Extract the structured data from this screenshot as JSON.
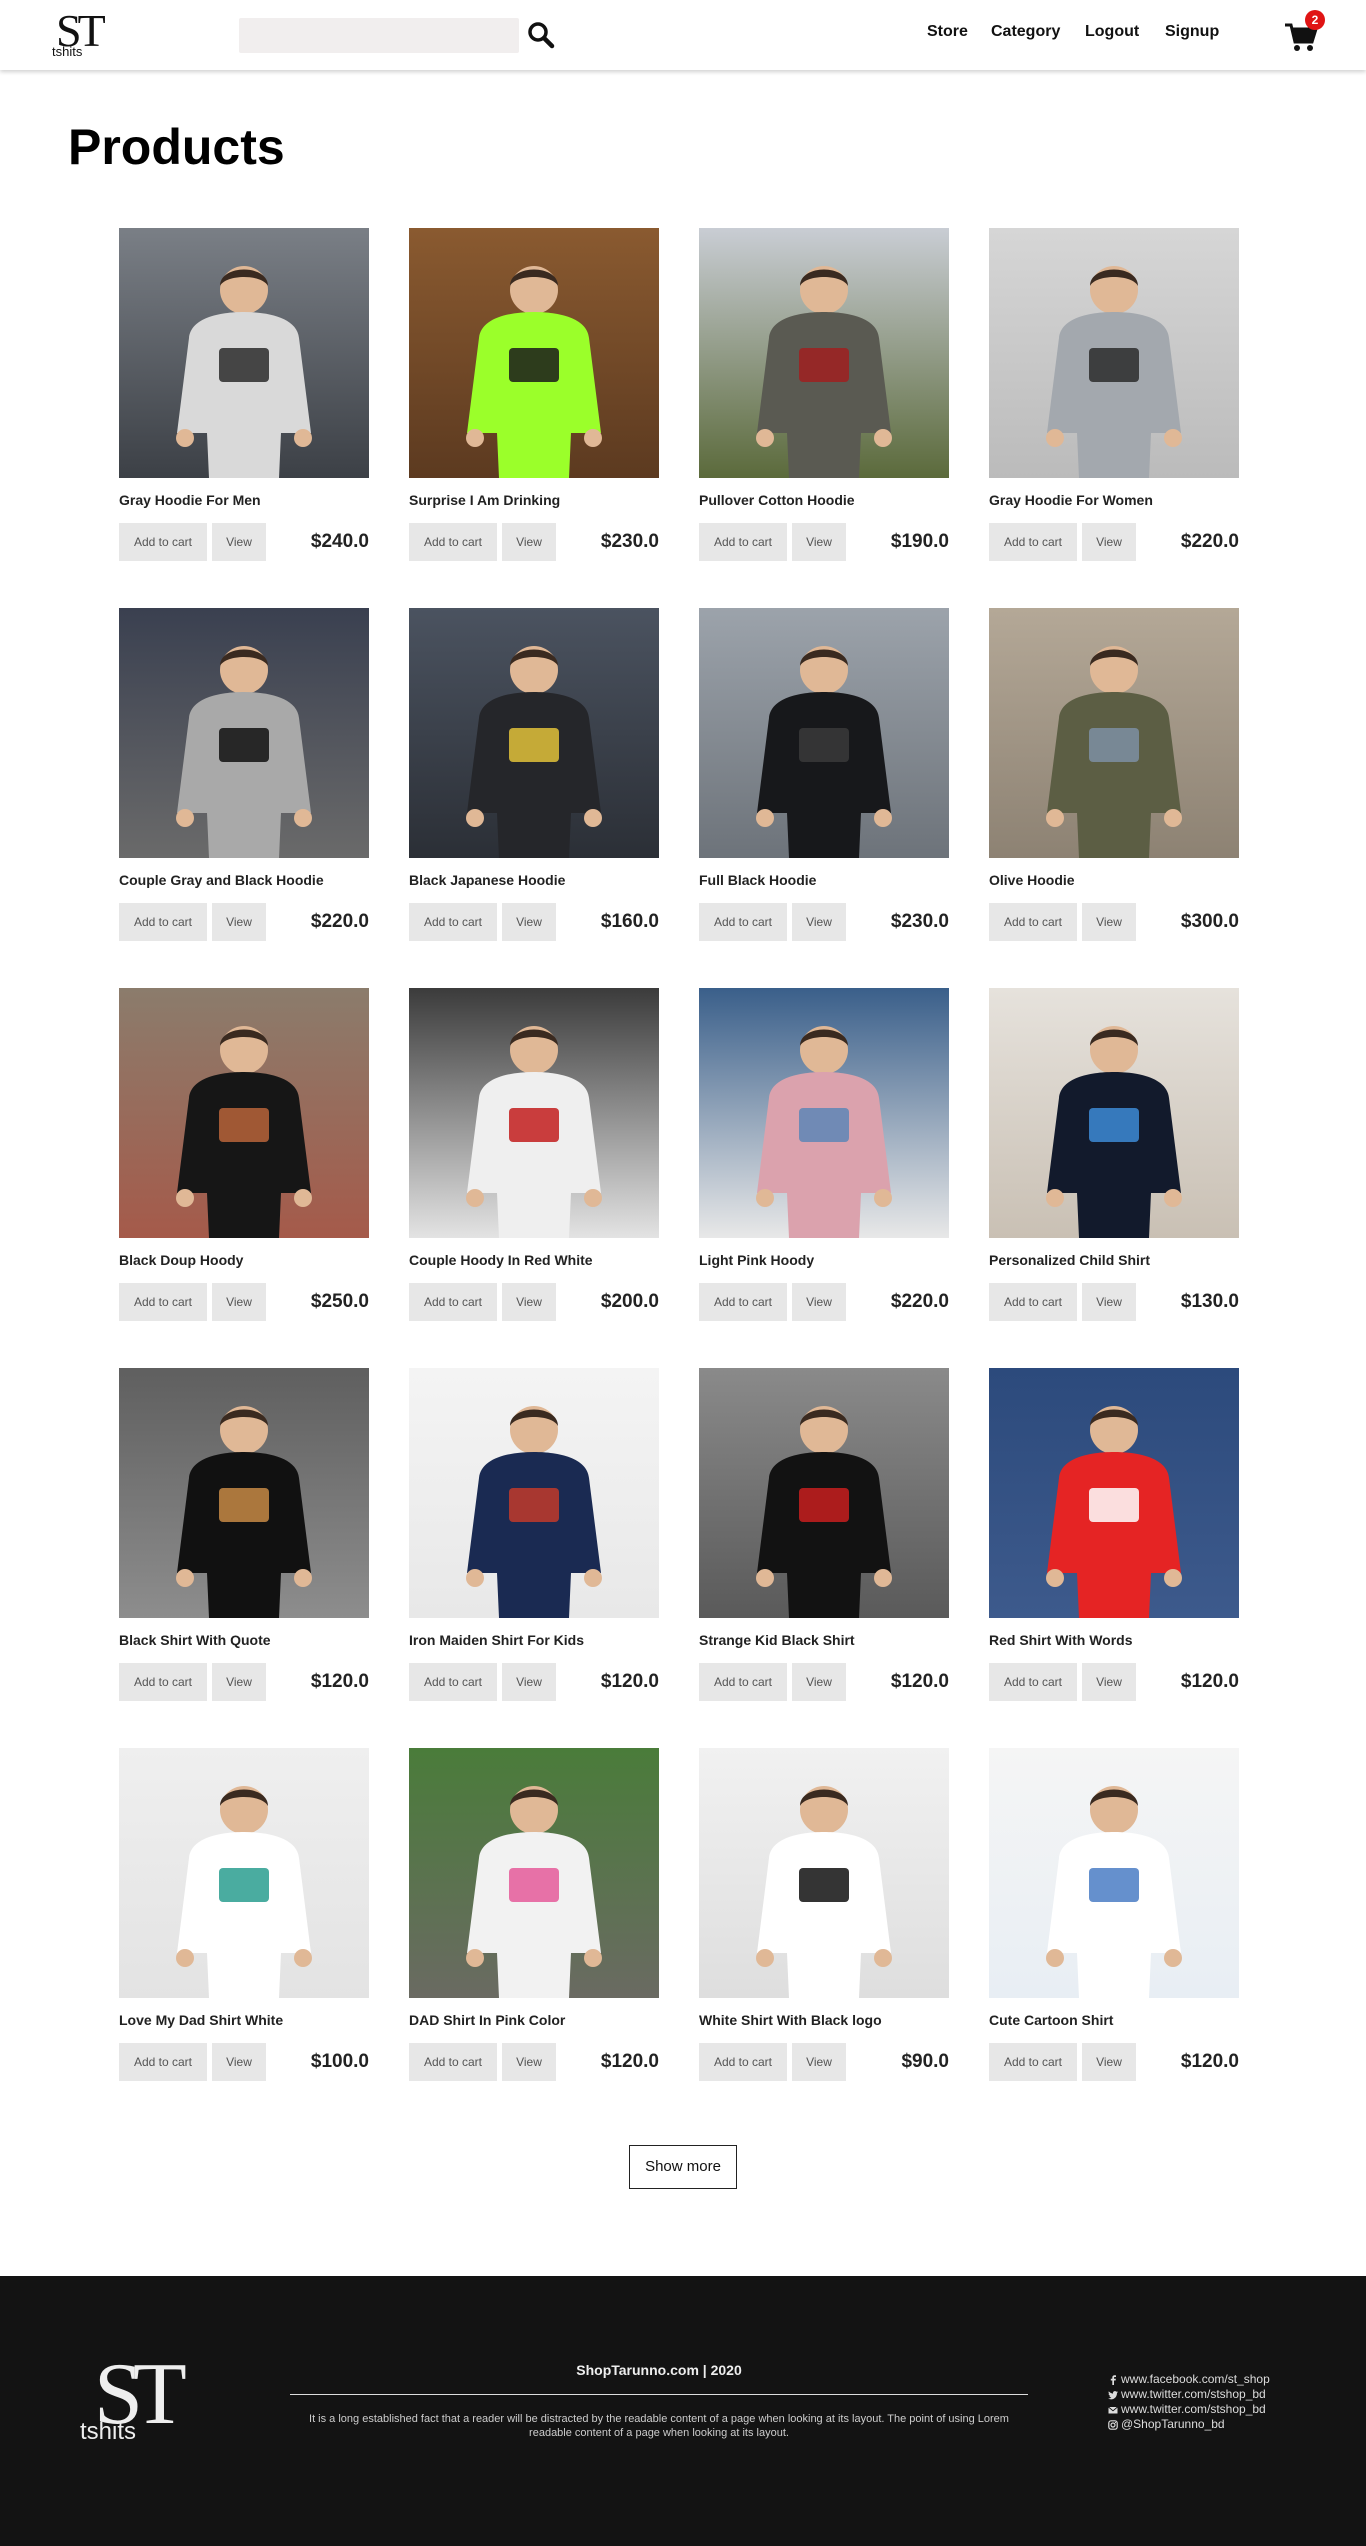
{
  "header": {
    "logo_big": "ST",
    "logo_small": "tshits",
    "search_placeholder": "",
    "nav": [
      "Store",
      "Category",
      "Logout",
      "Signup"
    ],
    "cart_count": "2"
  },
  "page_title": "Products",
  "products": [
    {
      "name": "Gray Hoodie For Men",
      "price": "$240.0"
    },
    {
      "name": "Surprise I Am Drinking",
      "price": "$230.0"
    },
    {
      "name": "Pullover Cotton Hoodie",
      "price": "$190.0"
    },
    {
      "name": "Gray Hoodie For Women",
      "price": "$220.0"
    },
    {
      "name": "Couple Gray and Black Hoodie",
      "price": "$220.0"
    },
    {
      "name": "Black Japanese Hoodie",
      "price": "$160.0"
    },
    {
      "name": "Full Black Hoodie",
      "price": "$230.0"
    },
    {
      "name": "Olive Hoodie",
      "price": "$300.0"
    },
    {
      "name": "Black Doup Hoody",
      "price": "$250.0"
    },
    {
      "name": "Couple Hoody In Red White",
      "price": "$200.0"
    },
    {
      "name": "Light Pink Hoody",
      "price": "$220.0"
    },
    {
      "name": "Personalized Child Shirt",
      "price": "$130.0"
    },
    {
      "name": "Black Shirt With Quote",
      "price": "$120.0"
    },
    {
      "name": "Iron Maiden Shirt For Kids",
      "price": "$120.0"
    },
    {
      "name": "Strange Kid Black Shirt",
      "price": "$120.0"
    },
    {
      "name": "Red Shirt With Words",
      "price": "$120.0"
    },
    {
      "name": "Love My Dad Shirt White",
      "price": "$100.0"
    },
    {
      "name": "DAD Shirt In Pink Color",
      "price": "$120.0"
    },
    {
      "name": "White Shirt With Black logo",
      "price": "$90.0"
    },
    {
      "name": "Cute Cartoon Shirt",
      "price": "$120.0"
    }
  ],
  "buttons": {
    "add_to_cart": "Add to cart",
    "view": "View"
  },
  "show_more": "Show more",
  "footer": {
    "logo_big": "ST",
    "logo_small": "tshits",
    "copyright": "ShopTarunno.com | 2020",
    "text": "It is a long established fact that a reader will be distracted by the readable content of a page when looking at its layout. The point of using Lorem readable content of a page when looking at its layout.",
    "social": [
      {
        "icon": "facebook-icon",
        "text": "www.facebook.com/st_shop"
      },
      {
        "icon": "twitter-icon",
        "text": "www.twitter.com/stshop_bd"
      },
      {
        "icon": "envelope-icon",
        "text": "www.twitter.com/stshop_bd"
      },
      {
        "icon": "instagram-icon",
        "text": "@ShopTarunno_bd"
      }
    ]
  }
}
